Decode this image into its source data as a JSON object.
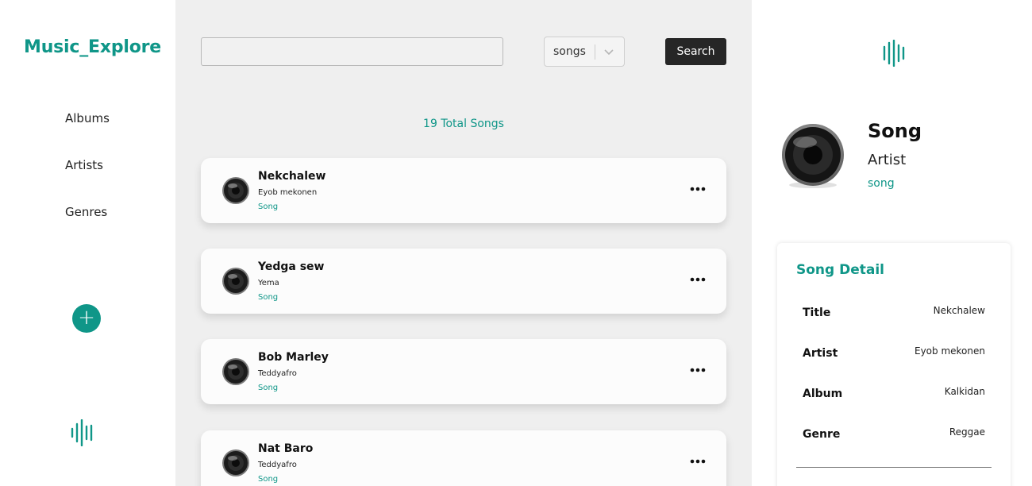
{
  "sidebar": {
    "brand": "Music_Explore",
    "nav": [
      {
        "label": "Albums"
      },
      {
        "label": "Artists"
      },
      {
        "label": "Genres"
      }
    ],
    "add_label": "+"
  },
  "search": {
    "value": "",
    "filter_value": "songs",
    "button_label": "Search"
  },
  "total_label": "19 Total Songs",
  "songs": [
    {
      "title": "Nekchalew",
      "artist": "Eyob mekonen",
      "type": "Song"
    },
    {
      "title": "Yedga sew",
      "artist": "Yema",
      "type": "Song"
    },
    {
      "title": "Bob Marley",
      "artist": "Teddyafro",
      "type": "Song"
    },
    {
      "title": "Nat Baro",
      "artist": "Teddyafro",
      "type": "Song"
    }
  ],
  "now_playing": {
    "title": "Song",
    "artist": "Artist",
    "type": "song"
  },
  "detail": {
    "heading": "Song Detail",
    "rows": [
      {
        "label": "Title",
        "value": "Nekchalew"
      },
      {
        "label": "Artist",
        "value": "Eyob mekonen"
      },
      {
        "label": "Album",
        "value": "Kalkidan"
      },
      {
        "label": "Genre",
        "value": "Reggae"
      }
    ]
  },
  "colors": {
    "accent": "#0f9688",
    "button_dark": "#262626",
    "main_bg": "#efefef"
  },
  "icons": [
    "soundwave-icon",
    "plus-icon",
    "speaker-icon",
    "more-dots-icon",
    "chevron-down-icon"
  ]
}
